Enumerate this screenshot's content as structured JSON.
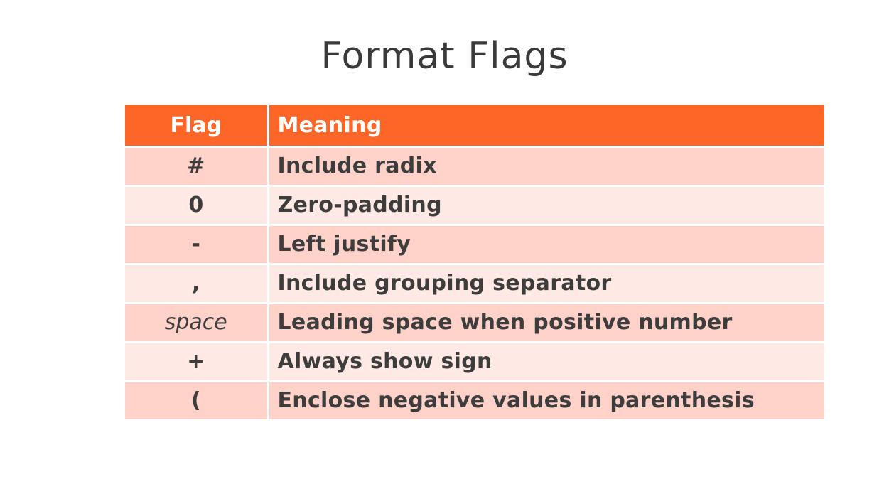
{
  "title": "Format Flags",
  "table": {
    "headers": {
      "flag": "Flag",
      "meaning": "Meaning"
    },
    "rows": [
      {
        "flag": "#",
        "meaning": "Include radix"
      },
      {
        "flag": "0",
        "meaning": "Zero-padding"
      },
      {
        "flag": "-",
        "meaning": "Left justify"
      },
      {
        "flag": ",",
        "meaning": "Include grouping separator"
      },
      {
        "flag": "space",
        "meaning": "Leading space when positive number"
      },
      {
        "flag": "+",
        "meaning": "Always show sign"
      },
      {
        "flag": "(",
        "meaning": "Enclose negative values in parenthesis"
      }
    ]
  },
  "colors": {
    "header_bg": "#fd6626",
    "row_dark": "#fed2c9",
    "row_light": "#fee9e4",
    "text": "#3d3d3d"
  }
}
